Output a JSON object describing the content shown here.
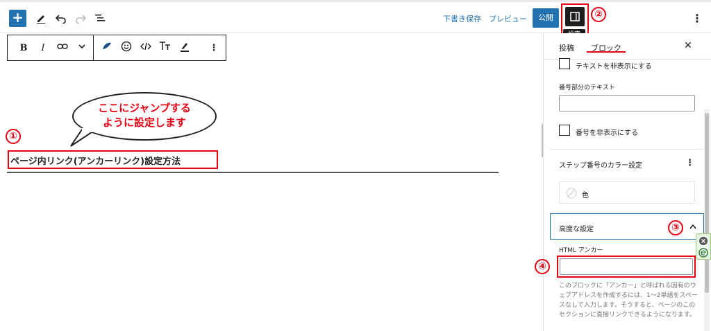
{
  "toolbar": {
    "add_symbol": "+",
    "save_draft": "下書き保存",
    "preview": "プレビュー",
    "publish": "公開",
    "settings_tooltip": "設定",
    "more_symbol": "⋮"
  },
  "annotations": {
    "n1": "①",
    "n2": "②",
    "n3": "③",
    "n4": "④",
    "bubble_line1": "ここにジャンプする",
    "bubble_line2": "ように設定します"
  },
  "block_toolbar": {
    "bold": "B",
    "italic": "I",
    "more": "⋮"
  },
  "editor": {
    "heading": "ページ内リンク(アンカーリンク)設定方法"
  },
  "sidebar": {
    "tab_post": "投稿",
    "tab_block": "ブロック",
    "close": "✕",
    "hide_text": "テキストを非表示にする",
    "number_text_label": "番号部分のテキスト",
    "number_text_value": "",
    "hide_number": "番号を非表示にする",
    "step_color_title": "ステップ番号のカラー設定",
    "color_label": "色",
    "advanced_title": "高度な設定",
    "html_anchor_label": "HTML アンカー",
    "html_anchor_value": "",
    "help_text": "このブロックに「アンカー」と呼ばれる固有のウェブアドレスを作成するには、1〜2単語をスペースなしで入力します。そうすると、ページのこのセクションに直接リンクできるようになります。"
  },
  "colors": {
    "accent": "#2271b1",
    "annotation_red": "#e60012"
  }
}
